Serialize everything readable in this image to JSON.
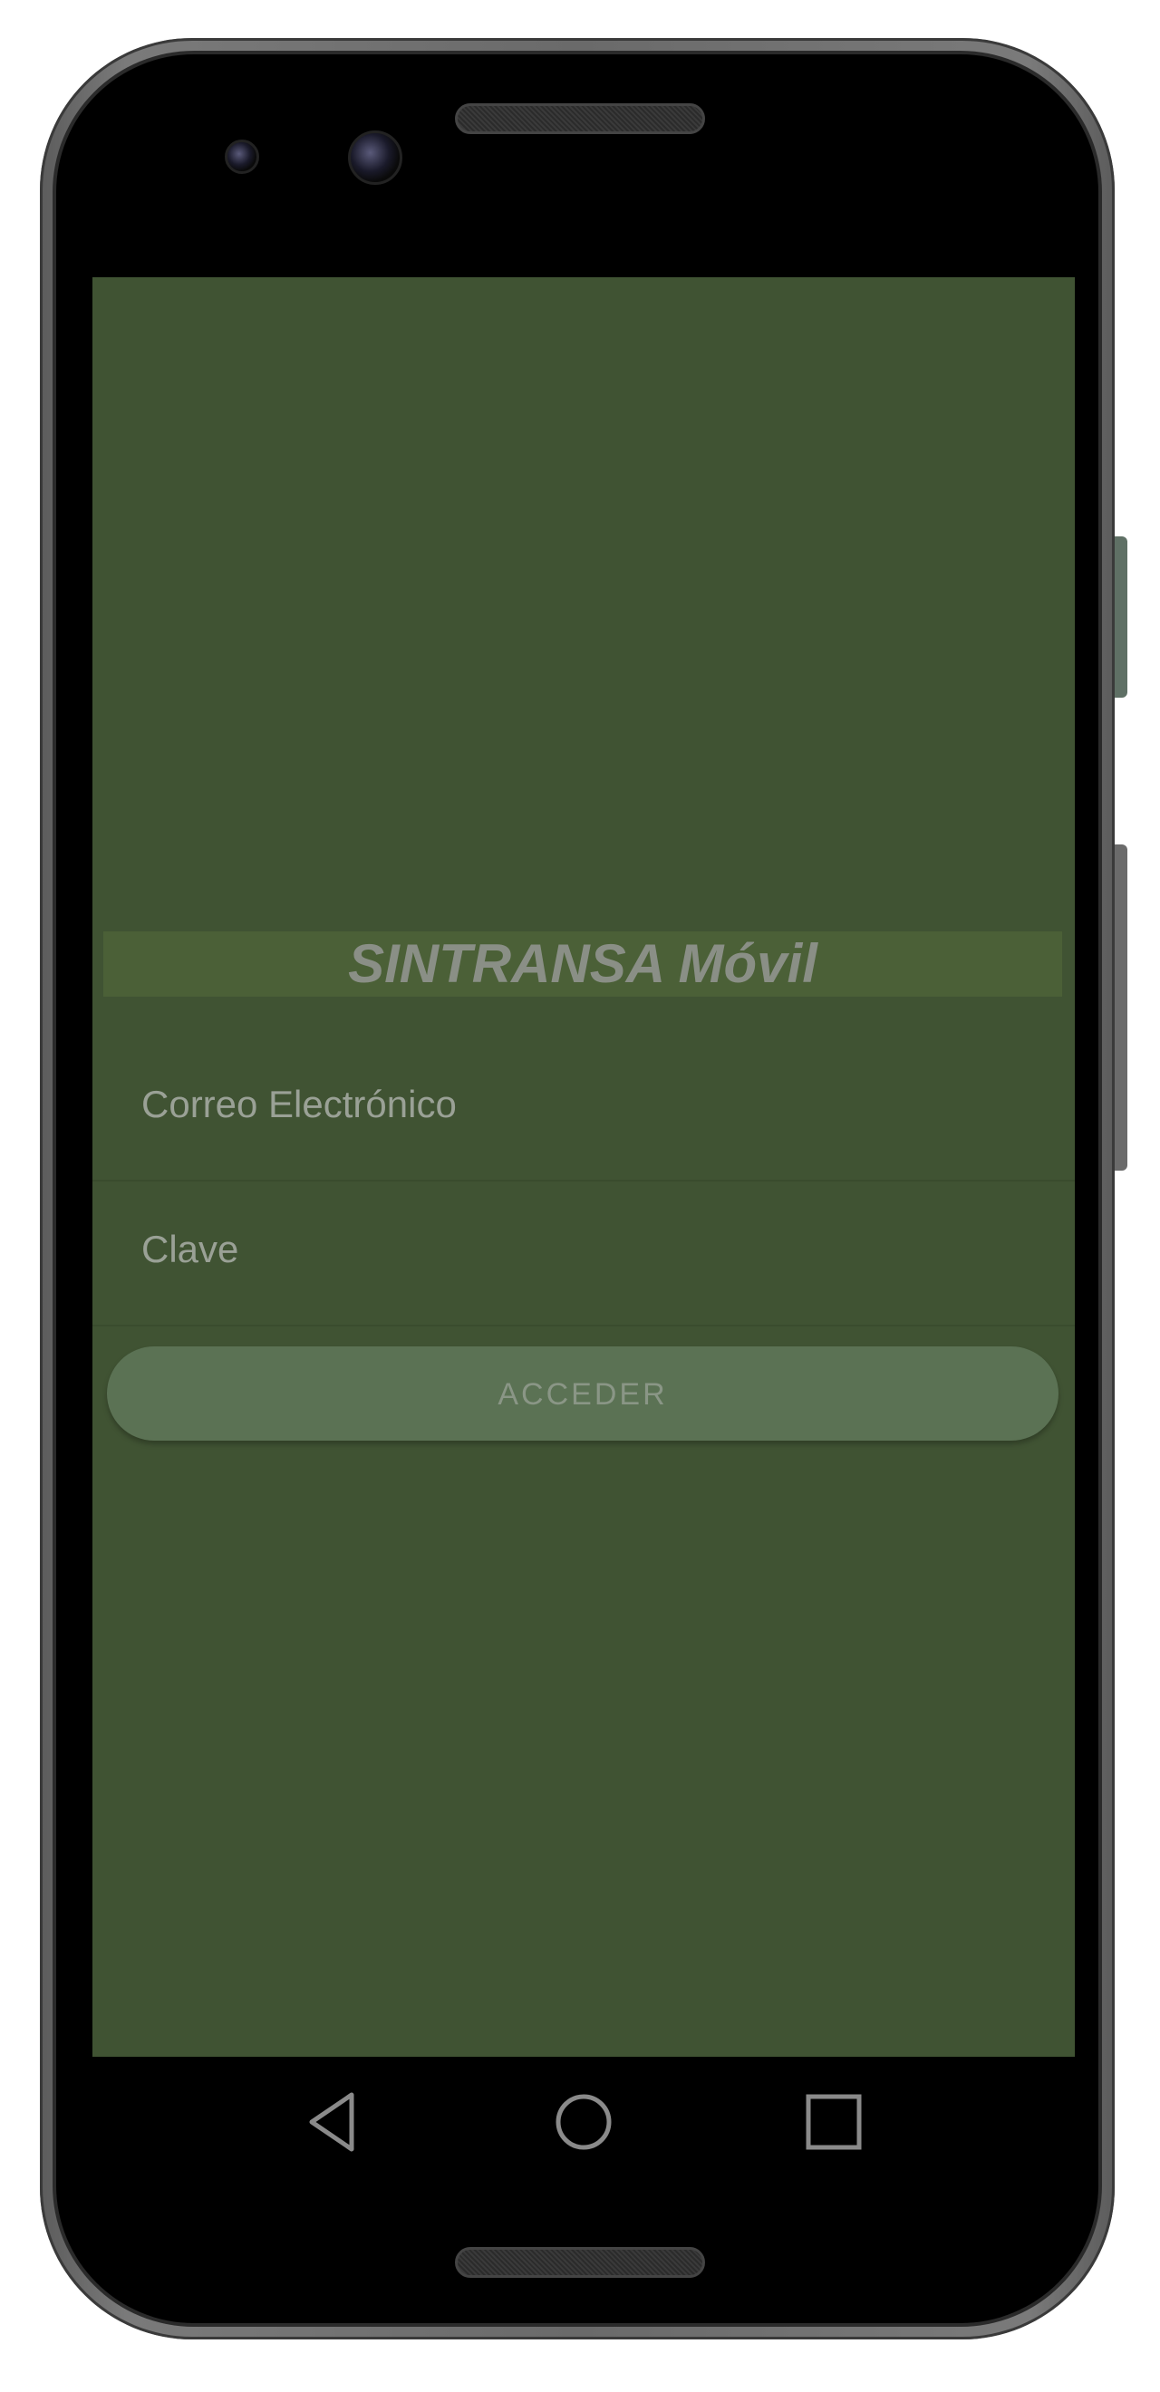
{
  "app": {
    "title": "SINTRANSA Móvil"
  },
  "login": {
    "email_placeholder": "Correo Electrónico",
    "password_placeholder": "Clave",
    "submit_label": "ACCEDER"
  },
  "navigation": {
    "back_icon": "back-triangle-icon",
    "home_icon": "home-circle-icon",
    "recent_icon": "recent-apps-square-icon"
  },
  "colors": {
    "screen_background": "#405333",
    "title_bar": "#4b6037",
    "button": "#5b7254"
  }
}
